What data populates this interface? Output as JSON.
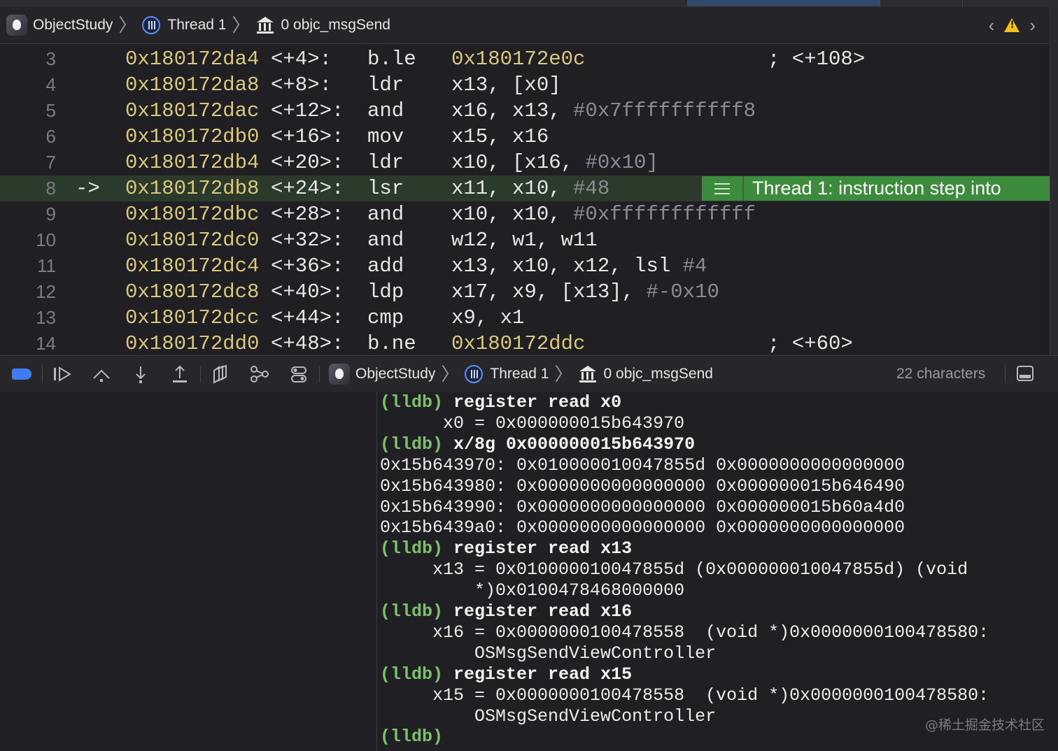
{
  "jump_bar": {
    "project": "ObjectStudy",
    "thread": "Thread 1",
    "frame": "0 objc_msgSend"
  },
  "disassembly": {
    "current_line": 8,
    "current_marker": "->",
    "status_badge": "Thread 1: instruction step into",
    "rows": [
      {
        "line": "3",
        "addr": "0x180172da4",
        "offset": "<+4>:",
        "mnemonic": "b.le",
        "ops": [
          {
            "t": "0x180172e0c",
            "k": "lit"
          }
        ],
        "comment": "; <+108>"
      },
      {
        "line": "4",
        "addr": "0x180172da8",
        "offset": "<+8>:",
        "mnemonic": "ldr",
        "ops": [
          {
            "t": "x13, [x0]",
            "k": "reg"
          }
        ],
        "comment": ""
      },
      {
        "line": "5",
        "addr": "0x180172dac",
        "offset": "<+12>:",
        "mnemonic": "and",
        "ops": [
          {
            "t": "x16, x13, ",
            "k": "reg"
          },
          {
            "t": "#0x7ffffffffff8",
            "k": "imm"
          }
        ],
        "comment": ""
      },
      {
        "line": "6",
        "addr": "0x180172db0",
        "offset": "<+16>:",
        "mnemonic": "mov",
        "ops": [
          {
            "t": "x15, x16",
            "k": "reg"
          }
        ],
        "comment": ""
      },
      {
        "line": "7",
        "addr": "0x180172db4",
        "offset": "<+20>:",
        "mnemonic": "ldr",
        "ops": [
          {
            "t": "x10, [x16, ",
            "k": "reg"
          },
          {
            "t": "#0x10]",
            "k": "imm"
          }
        ],
        "comment": ""
      },
      {
        "line": "8",
        "addr": "0x180172db8",
        "offset": "<+24>:",
        "mnemonic": "lsr",
        "ops": [
          {
            "t": "x11, x10, ",
            "k": "reg"
          },
          {
            "t": "#48",
            "k": "imm"
          }
        ],
        "comment": ""
      },
      {
        "line": "9",
        "addr": "0x180172dbc",
        "offset": "<+28>:",
        "mnemonic": "and",
        "ops": [
          {
            "t": "x10, x10, ",
            "k": "reg"
          },
          {
            "t": "#0xffffffffffff",
            "k": "imm"
          }
        ],
        "comment": ""
      },
      {
        "line": "10",
        "addr": "0x180172dc0",
        "offset": "<+32>:",
        "mnemonic": "and",
        "ops": [
          {
            "t": "w12, w1, w11",
            "k": "reg"
          }
        ],
        "comment": ""
      },
      {
        "line": "11",
        "addr": "0x180172dc4",
        "offset": "<+36>:",
        "mnemonic": "add",
        "ops": [
          {
            "t": "x13, x10, x12, lsl ",
            "k": "reg"
          },
          {
            "t": "#4",
            "k": "imm"
          }
        ],
        "comment": ""
      },
      {
        "line": "12",
        "addr": "0x180172dc8",
        "offset": "<+40>:",
        "mnemonic": "ldp",
        "ops": [
          {
            "t": "x17, x9, [x13], ",
            "k": "reg"
          },
          {
            "t": "#-0x10",
            "k": "imm"
          }
        ],
        "comment": ""
      },
      {
        "line": "13",
        "addr": "0x180172dcc",
        "offset": "<+44>:",
        "mnemonic": "cmp",
        "ops": [
          {
            "t": "x9, x1",
            "k": "reg"
          }
        ],
        "comment": ""
      },
      {
        "line": "14",
        "addr": "0x180172dd0",
        "offset": "<+48>:",
        "mnemonic": "b.ne",
        "ops": [
          {
            "t": "0x180172ddc",
            "k": "lit"
          }
        ],
        "comment": "; <+60>"
      }
    ]
  },
  "debug_bar": {
    "project": "ObjectStudy",
    "thread": "Thread 1",
    "frame": "0 objc_msgSend",
    "char_count": "22 characters",
    "tools": [
      "breakpoints-toggle",
      "continue",
      "step-over",
      "step-into",
      "step-out",
      "view-hierarchy",
      "memory-graph",
      "environment-overrides"
    ]
  },
  "console": {
    "lines": [
      {
        "indent": "",
        "prompt": "(lldb) ",
        "cmd": "register read x0",
        "text": ""
      },
      {
        "indent": "      ",
        "prompt": "",
        "cmd": "",
        "text": "x0 = 0x000000015b643970"
      },
      {
        "indent": "",
        "prompt": "(lldb) ",
        "cmd": "x/8g 0x000000015b643970",
        "text": ""
      },
      {
        "indent": "",
        "prompt": "",
        "cmd": "",
        "text": "0x15b643970: 0x010000010047855d 0x0000000000000000"
      },
      {
        "indent": "",
        "prompt": "",
        "cmd": "",
        "text": "0x15b643980: 0x0000000000000000 0x000000015b646490"
      },
      {
        "indent": "",
        "prompt": "",
        "cmd": "",
        "text": "0x15b643990: 0x0000000000000000 0x000000015b60a4d0"
      },
      {
        "indent": "",
        "prompt": "",
        "cmd": "",
        "text": "0x15b6439a0: 0x0000000000000000 0x0000000000000000"
      },
      {
        "indent": "",
        "prompt": "(lldb) ",
        "cmd": "register read x13",
        "text": ""
      },
      {
        "indent": "     ",
        "prompt": "",
        "cmd": "",
        "text": "x13 = 0x010000010047855d (0x000000010047855d) (void"
      },
      {
        "indent": "         ",
        "prompt": "",
        "cmd": "",
        "text": "*)0x0100478468000000"
      },
      {
        "indent": "",
        "prompt": "(lldb) ",
        "cmd": "register read x16",
        "text": ""
      },
      {
        "indent": "     ",
        "prompt": "",
        "cmd": "",
        "text": "x16 = 0x0000000100478558  (void *)0x0000000100478580:"
      },
      {
        "indent": "         ",
        "prompt": "",
        "cmd": "",
        "text": "OSMsgSendViewController"
      },
      {
        "indent": "",
        "prompt": "(lldb) ",
        "cmd": "register read x15",
        "text": ""
      },
      {
        "indent": "     ",
        "prompt": "",
        "cmd": "",
        "text": "x15 = 0x0000000100478558  (void *)0x0000000100478580:"
      },
      {
        "indent": "         ",
        "prompt": "",
        "cmd": "",
        "text": "OSMsgSendViewController"
      },
      {
        "indent": "",
        "prompt": "(lldb)",
        "cmd": "",
        "text": ""
      }
    ]
  },
  "watermark": "@稀土掘金技术社区",
  "colors": {
    "accent_blue": "#3e7cf0",
    "current_line_green": "#3d8b3d",
    "address_yellow": "#d9c97c",
    "prompt_green": "#7cc06b"
  }
}
